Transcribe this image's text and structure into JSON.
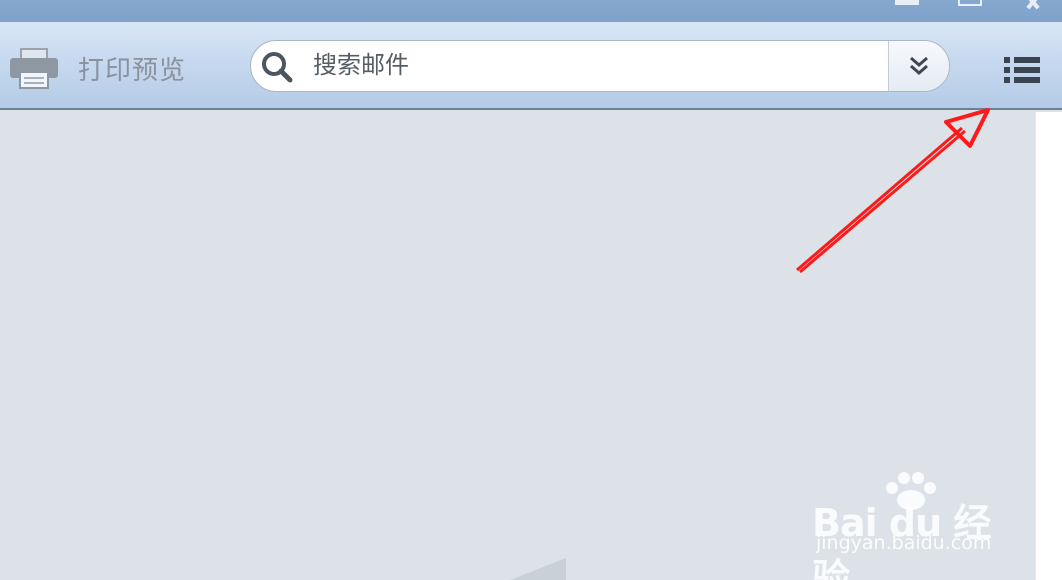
{
  "toolbar": {
    "print_preview_label": "打印预览",
    "search_placeholder": "搜索邮件"
  },
  "watermark": {
    "brand": "Bai du 经验",
    "url": "jingyan.baidu.com"
  },
  "colors": {
    "titlebar": "#86a8cf",
    "toolbar_top": "#d9e6f6",
    "toolbar_bottom": "#b4cbe6",
    "content_bg": "#dde2e8",
    "arrow": "#ff1a1a",
    "icon": "#3b4552"
  }
}
